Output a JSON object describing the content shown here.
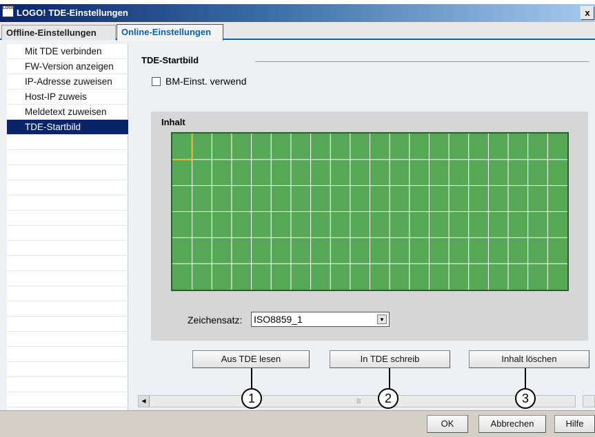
{
  "window": {
    "title": "LOGO! TDE-Einstellungen",
    "close_label": "x",
    "logo_text": "LOGO"
  },
  "tabs": [
    {
      "label": "Offline-Einstellungen",
      "active": false
    },
    {
      "label": "Online-Einstellungen",
      "active": true
    }
  ],
  "nav": {
    "items": [
      {
        "label": "Mit TDE verbinden",
        "selected": false
      },
      {
        "label": "FW-Version anzeigen",
        "selected": false
      },
      {
        "label": "IP-Adresse zuweisen",
        "selected": false
      },
      {
        "label": "Host-IP zuweis",
        "selected": false
      },
      {
        "label": "Meldetext zuweisen",
        "selected": false
      },
      {
        "label": "TDE-Startbild",
        "selected": true
      }
    ]
  },
  "panel": {
    "group_title": "TDE-Startbild",
    "checkbox_label": "BM-Einst. verwend",
    "checkbox_checked": false,
    "content_title": "Inhalt",
    "grid": {
      "columns": 20,
      "rows": 6,
      "cell_color": "#56a857",
      "line_color": "#ffffff",
      "cursor_color": "#e8c040"
    },
    "charset_label": "Zeichensatz:",
    "charset_value": "ISO8859_1",
    "buttons": {
      "read": "Aus TDE lesen",
      "write": "In TDE schreib",
      "clear": "Inhalt löschen"
    },
    "markers": [
      "1",
      "2",
      "3"
    ]
  },
  "footer": {
    "ok": "OK",
    "cancel": "Abbrechen",
    "help": "Hilfe"
  },
  "colors": {
    "titlebar": "#0a246a",
    "selection": "#0a246a",
    "tab_accent": "#0a5fa8"
  }
}
